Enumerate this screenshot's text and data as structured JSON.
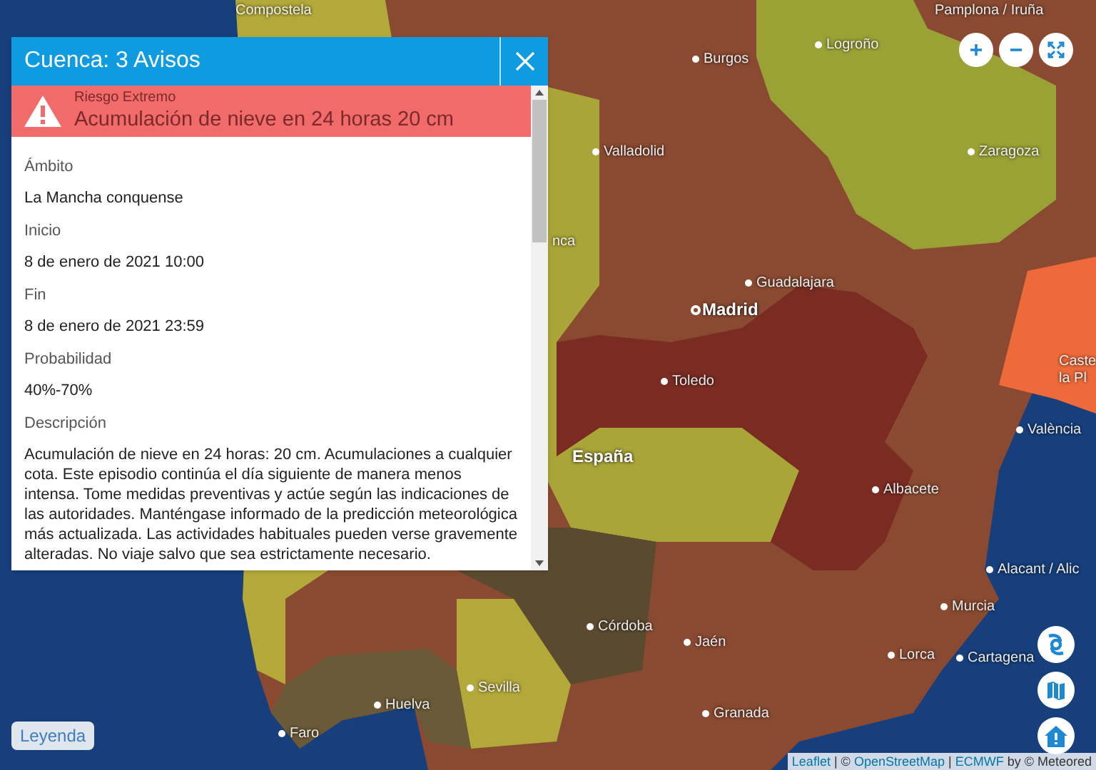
{
  "panel": {
    "title": "Cuenca: 3 Avisos",
    "alert": {
      "level_label": "Riesgo Extremo",
      "title": "Acumulación de nieve en 24 horas 20 cm",
      "color": "#f26b6b"
    },
    "fields": [
      {
        "label": "Ámbito",
        "value": "La Mancha conquense"
      },
      {
        "label": "Inicio",
        "value": "8 de enero de 2021 10:00"
      },
      {
        "label": "Fin",
        "value": "8 de enero de 2021 23:59"
      },
      {
        "label": "Probabilidad",
        "value": "40%-70%"
      },
      {
        "label": "Descripción",
        "value": "Acumulación de nieve en 24 horas: 20 cm. Acumulaciones a cualquier cota. Este episodio continúa el día siguiente de manera menos intensa. Tome medidas preventivas y actúe según las indicaciones de las autoridades. Manténgase informado de la predicción meteorológica más actualizada. Las actividades habituales pueden verse gravemente alteradas. No viaje salvo que sea estrictamente necesario."
      }
    ]
  },
  "map": {
    "places": [
      {
        "name": "Compostela",
        "kind": "city"
      },
      {
        "name": "Pamplona / Iruña",
        "kind": "city"
      },
      {
        "name": "Burgos",
        "kind": "city"
      },
      {
        "name": "Logroño",
        "kind": "city"
      },
      {
        "name": "Valladolid",
        "kind": "city"
      },
      {
        "name": "Zaragoza",
        "kind": "city"
      },
      {
        "name": "nca",
        "kind": "city"
      },
      {
        "name": "Guadalajara",
        "kind": "city"
      },
      {
        "name": "Madrid",
        "kind": "capital"
      },
      {
        "name": "Caste la Pl",
        "kind": "city"
      },
      {
        "name": "Toledo",
        "kind": "city"
      },
      {
        "name": "València",
        "kind": "city"
      },
      {
        "name": "España",
        "kind": "country"
      },
      {
        "name": "Albacete",
        "kind": "city"
      },
      {
        "name": "Alacant / Alic",
        "kind": "city"
      },
      {
        "name": "Murcia",
        "kind": "city"
      },
      {
        "name": "Córdoba",
        "kind": "city"
      },
      {
        "name": "Jaén",
        "kind": "city"
      },
      {
        "name": "Lorca",
        "kind": "city"
      },
      {
        "name": "Cartagena",
        "kind": "city"
      },
      {
        "name": "Sevilla",
        "kind": "city"
      },
      {
        "name": "Huelva",
        "kind": "city"
      },
      {
        "name": "Granada",
        "kind": "city"
      },
      {
        "name": "Faro",
        "kind": "city"
      }
    ],
    "legend_button": "Leyenda",
    "attribution": [
      {
        "text": "Leaflet",
        "kind": "link"
      },
      {
        "text": " | © ",
        "kind": "text"
      },
      {
        "text": "OpenStreetMap",
        "kind": "link"
      },
      {
        "text": " | ",
        "kind": "text"
      },
      {
        "text": "ECMWF",
        "kind": "link"
      },
      {
        "text": " by © Meteored",
        "kind": "text"
      }
    ]
  }
}
